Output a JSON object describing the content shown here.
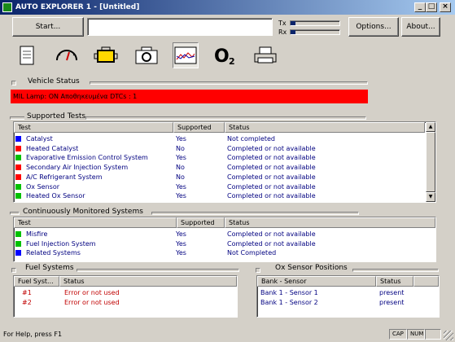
{
  "window": {
    "title": "AUTO EXPLORER 1 - [Untitled]"
  },
  "toolbar": {
    "start_label": "Start...",
    "options_label": "Options...",
    "about_label": "About...",
    "tx_label": "Tx",
    "rx_label": "Rx",
    "tx_level": 0.1,
    "rx_level": 0.1
  },
  "icons": [
    "document-icon",
    "gauge-icon",
    "engine-icon",
    "camera-icon",
    "graph-icon",
    "o2-sensor-icon",
    "printer-icon"
  ],
  "vehicle_status": {
    "title": "Vehicle Status",
    "banner": "MIL Lamp: ON  Αποθηκευμένα DTCs : 1",
    "banner_color": "#ff0000"
  },
  "supported_tests": {
    "title": "Supported Tests",
    "headers": [
      "Test",
      "Supported",
      "Status"
    ],
    "rows": [
      {
        "test": "Catalyst",
        "supported": "Yes",
        "status": "Not completed",
        "color": "#0000ff"
      },
      {
        "test": "Heated Catalyst",
        "supported": "No",
        "status": "Completed or not available",
        "color": "#ff0000"
      },
      {
        "test": "Evaporative Emission Control System",
        "supported": "Yes",
        "status": "Completed or not available",
        "color": "#00c000"
      },
      {
        "test": "Secondary Air Injection System",
        "supported": "No",
        "status": "Completed or not available",
        "color": "#ff0000"
      },
      {
        "test": "A/C Refrigerant System",
        "supported": "No",
        "status": "Completed or not available",
        "color": "#ff0000"
      },
      {
        "test": "Ox Sensor",
        "supported": "Yes",
        "status": "Completed or not available",
        "color": "#00c000"
      },
      {
        "test": "Heated Ox Sensor",
        "supported": "Yes",
        "status": "Completed or not available",
        "color": "#00c000"
      }
    ]
  },
  "continuous": {
    "title": "Continuously Monitored Systems",
    "headers": [
      "Test",
      "Supported",
      "Status"
    ],
    "rows": [
      {
        "test": "Misfire",
        "supported": "Yes",
        "status": "Completed or not available",
        "color": "#00c000"
      },
      {
        "test": "Fuel Injection System",
        "supported": "Yes",
        "status": "Completed or not available",
        "color": "#00c000"
      },
      {
        "test": "Related Systems",
        "supported": "Yes",
        "status": "Not Completed",
        "color": "#0000ff"
      }
    ]
  },
  "fuel_systems": {
    "title": "Fuel Systems",
    "headers": [
      "Fuel Syst...",
      "Status"
    ],
    "rows": [
      {
        "name": "#1",
        "status": "Error or not used"
      },
      {
        "name": "#2",
        "status": "Error or not used"
      }
    ]
  },
  "ox_positions": {
    "title": "Ox Sensor Positions",
    "headers": [
      "Bank - Sensor",
      "Status"
    ],
    "rows": [
      {
        "sensor": "Bank 1 - Sensor 1",
        "status": "present"
      },
      {
        "sensor": "Bank 1 - Sensor 2",
        "status": "present"
      }
    ]
  },
  "statusbar": {
    "help": "For Help, press F1",
    "cap": "CAP",
    "num": "NUM"
  }
}
